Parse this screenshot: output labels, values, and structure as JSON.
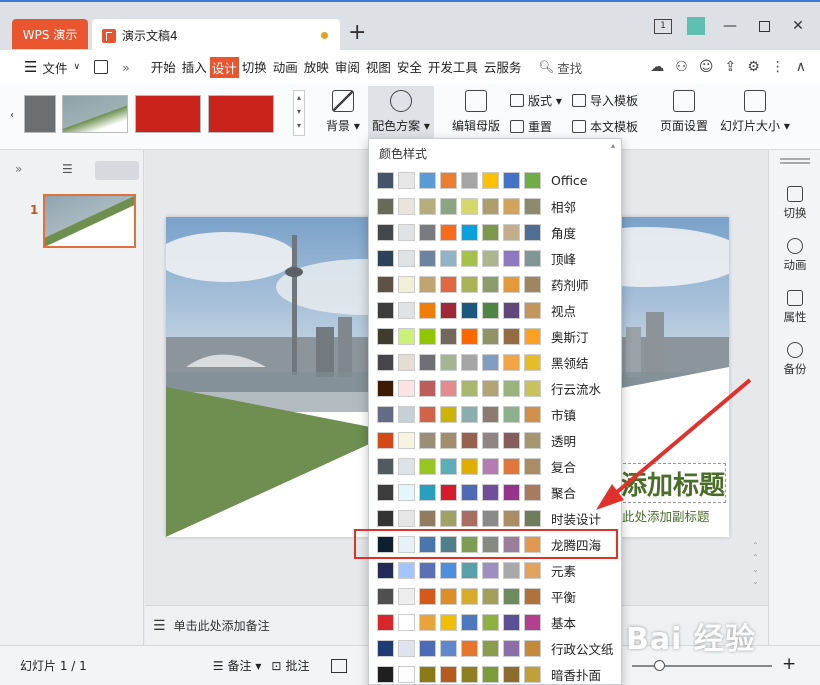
{
  "titlebar": {
    "app_tab": "WPS 演示",
    "doc_tab": "演示文稿4",
    "page_num": "1"
  },
  "menu": {
    "file": "文件",
    "items": [
      "开始",
      "插入",
      "设计",
      "切换",
      "动画",
      "放映",
      "审阅",
      "视图",
      "安全",
      "开发工具",
      "云服务"
    ],
    "active": "设计",
    "search": "查找"
  },
  "ribbon": {
    "background": "背景",
    "color_scheme": "配色方案",
    "edit_master": "编辑母版",
    "layout": "版式",
    "import_template": "导入模板",
    "reset": "重置",
    "text_template": "本文模板",
    "page_setup": "页面设置",
    "slide_size": "幻灯片大小"
  },
  "left_panel": {
    "slide_number": "1"
  },
  "right_panel": {
    "items": [
      "切换",
      "动画",
      "属性",
      "备份"
    ]
  },
  "slide": {
    "title": "添加标题",
    "subtitle": "此处添加副标题",
    "title_color": "#4a6e2a"
  },
  "notes": {
    "placeholder": "单击此处添加备注"
  },
  "status": {
    "slide_info": "幻灯片 1 / 1",
    "notes_btn": "备注",
    "comment_btn": "批注"
  },
  "dropdown": {
    "header": "颜色样式",
    "schemes": [
      {
        "name": "Office",
        "colors": [
          "#44546a",
          "#e7e6e6",
          "#5b9bd5",
          "#ed7d31",
          "#a5a5a5",
          "#ffc000",
          "#4472c4",
          "#70ad47"
        ]
      },
      {
        "name": "相邻",
        "colors": [
          "#676a55",
          "#e9e5dc",
          "#b6ad7d",
          "#8ba582",
          "#d6d86b",
          "#ad9e6c",
          "#d2a35a",
          "#8e8a6d"
        ]
      },
      {
        "name": "角度",
        "colors": [
          "#45484b",
          "#dfe3e5",
          "#797b7e",
          "#f96a1b",
          "#08a1d9",
          "#7c984a",
          "#c2ad8d",
          "#506e94"
        ]
      },
      {
        "name": "顶峰",
        "colors": [
          "#2c4256",
          "#dfe3e5",
          "#6e839e",
          "#8eb4c6",
          "#a5c149",
          "#adb58d",
          "#8d78c2",
          "#7f9795"
        ]
      },
      {
        "name": "药剂师",
        "colors": [
          "#5e5145",
          "#f1f1d8",
          "#bfa670",
          "#e26740",
          "#a9b256",
          "#8b9d6a",
          "#e59a39",
          "#9d8760"
        ]
      },
      {
        "name": "视点",
        "colors": [
          "#3c3c3c",
          "#dfe3e5",
          "#f07f09",
          "#9f2936",
          "#1b587c",
          "#4e8542",
          "#604878",
          "#c19859"
        ]
      },
      {
        "name": "奥斯汀",
        "colors": [
          "#3e3d2d",
          "#caf278",
          "#94c600",
          "#71685a",
          "#ff6700",
          "#909465",
          "#956b43",
          "#fea022"
        ]
      },
      {
        "name": "黑领结",
        "colors": [
          "#46464a",
          "#e5ddd1",
          "#6f6f74",
          "#a5b592",
          "#a5a5a5",
          "#809ec2",
          "#f3a447",
          "#e7bc29"
        ]
      },
      {
        "name": "行云流水",
        "colors": [
          "#3c1a05",
          "#fbe2e4",
          "#be5b5b",
          "#e28c8d",
          "#a8b66e",
          "#b1a573",
          "#9cb27c",
          "#c9c15b"
        ]
      },
      {
        "name": "市镇",
        "colors": [
          "#646b86",
          "#c5d1d7",
          "#d16349",
          "#ccb400",
          "#8cadae",
          "#8c7b70",
          "#8fb08c",
          "#d19049"
        ]
      },
      {
        "name": "透明",
        "colors": [
          "#d34817",
          "#f7f3de",
          "#9b8e78",
          "#a28e6a",
          "#956251",
          "#918485",
          "#855d5d",
          "#a59670"
        ]
      },
      {
        "name": "复合",
        "colors": [
          "#515a5e",
          "#dde3e6",
          "#98c723",
          "#59b0b9",
          "#deae00",
          "#b77bb4",
          "#e0773c",
          "#a98d63"
        ]
      },
      {
        "name": "聚合",
        "colors": [
          "#3c3c3c",
          "#e3f6fc",
          "#28a0bd",
          "#d61c2b",
          "#4f6ab5",
          "#6f4f9c",
          "#94348c",
          "#a87b61"
        ]
      },
      {
        "name": "时装设计",
        "colors": [
          "#333333",
          "#e6e6e6",
          "#917c5f",
          "#9ea263",
          "#a86e62",
          "#8a8a8a",
          "#aa8c65",
          "#6f7d5d"
        ]
      },
      {
        "name": "龙腾四海",
        "colors": [
          "#0f1f2e",
          "#e7f1f8",
          "#4a77ab",
          "#4f7f8a",
          "#7c9d53",
          "#878a80",
          "#9a7e9a",
          "#e0994e"
        ]
      },
      {
        "name": "元素",
        "colors": [
          "#232a56",
          "#a4c6ff",
          "#5a6fb4",
          "#4d8fdc",
          "#5b9fa8",
          "#9d8fc1",
          "#a9a9a9",
          "#e2a35c"
        ]
      },
      {
        "name": "平衡",
        "colors": [
          "#4f4f4f",
          "#eeeeee",
          "#d55918",
          "#dd8f26",
          "#d7ab2e",
          "#a5a058",
          "#6c8b5e",
          "#b0723d"
        ]
      },
      {
        "name": "基本",
        "colors": [
          "#d7262c",
          "#ffffff",
          "#e8a33a",
          "#f2bf00",
          "#4e78bd",
          "#8fb144",
          "#5d5195",
          "#b1418c"
        ]
      },
      {
        "name": "行政公文纸",
        "colors": [
          "#1f3b73",
          "#dfe3ee",
          "#4c6bb6",
          "#5e88c9",
          "#e5762c",
          "#8c9c4d",
          "#8b6da8",
          "#c48a3a"
        ]
      },
      {
        "name": "暗香扑面",
        "colors": [
          "#1f1f1f",
          "#fdfdfd",
          "#8a7a16",
          "#b65a20",
          "#8e7f23",
          "#7a9d3a",
          "#8b6b2e",
          "#c0a03b"
        ]
      }
    ]
  },
  "watermark": "Bai 经验"
}
